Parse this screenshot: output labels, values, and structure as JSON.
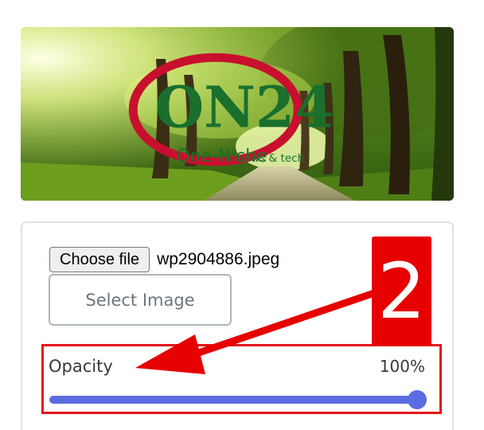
{
  "preview": {
    "logo_text": "ON24",
    "logo_subtext": "One-Niche",
    "logo_tagline": "news & tech"
  },
  "file_input": {
    "button_label": "Choose file",
    "file_name": "wp2904886.jpeg"
  },
  "select_image": {
    "label": "Select Image"
  },
  "opacity": {
    "label": "Opacity",
    "value_text": "100%",
    "value": 1.0
  },
  "annotation": {
    "step_number": "2",
    "color": "#e60000"
  },
  "colors": {
    "accent": "#5b6ce0",
    "highlight": "#e3151d",
    "card_border": "#dee2e6"
  }
}
